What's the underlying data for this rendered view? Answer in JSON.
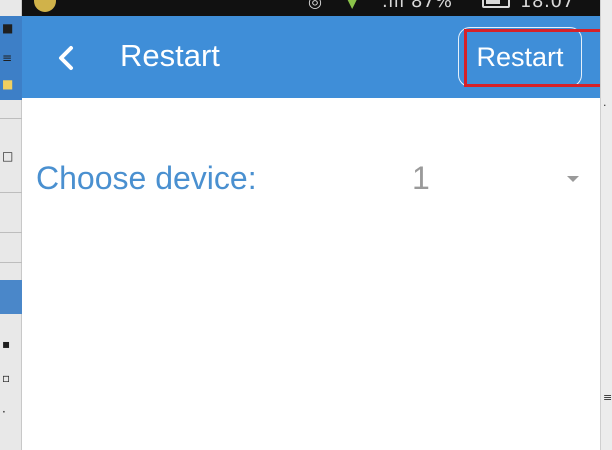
{
  "toolbar": {
    "title": "Restart",
    "back_icon": "chevron-left-icon",
    "action_label": "Restart"
  },
  "form": {
    "device_label": "Choose device:",
    "device_value": "1",
    "dropdown_icon": "dropdown-arrow-icon"
  },
  "colors": {
    "toolbar": "#3f8ed8",
    "label": "#4a90d0",
    "highlight": "#d62128"
  }
}
